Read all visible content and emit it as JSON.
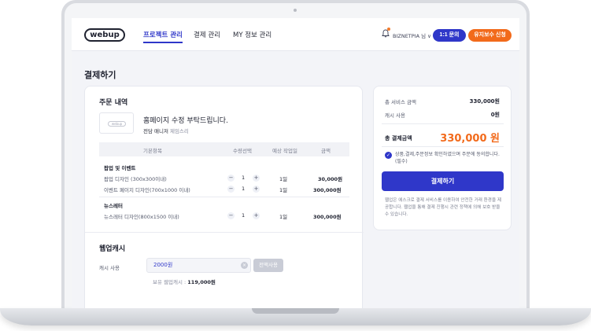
{
  "header": {
    "logo": "webup",
    "nav": [
      "프로젝트 관리",
      "결제 관리",
      "MY 정보 관리"
    ],
    "user": "BIZNETPIA 님 ∨",
    "inquiry_button": "1:1 문의",
    "maintenance_button": "유지보수 신청"
  },
  "page_title": "결제하기",
  "order": {
    "title": "주문 내역",
    "thumb_logo": "webup",
    "product_name": "홈페이지 수정 부탁드립니다.",
    "manager_label": "전담 매니저",
    "manager_name": "제임스리",
    "columns": [
      "기본항목",
      "수량선택",
      "예상 작업일",
      "금액"
    ],
    "groups": [
      {
        "name": "팝업 및 이벤트",
        "items": [
          {
            "name": "팝업 디자인 (300x300이내)",
            "qty": "1",
            "days": "1일",
            "amount": "30,000원"
          },
          {
            "name": "이벤트 페이지 디자인(700x1000 이내)",
            "qty": "1",
            "days": "1일",
            "amount": "300,000원"
          }
        ]
      },
      {
        "name": "뉴스레터",
        "items": [
          {
            "name": "뉴스레터 디자인(800x1500 이내)",
            "qty": "1",
            "days": "1일",
            "amount": "300,000원"
          }
        ]
      }
    ],
    "stepper": {
      "minus": "−",
      "plus": "+"
    }
  },
  "cash": {
    "title": "웹업캐시",
    "label": "캐시 사용",
    "value": "2000원",
    "clear": "×",
    "use_all": "전액사용",
    "own_label": "보유 웹업캐시 :",
    "own_value": "119,000원"
  },
  "summary": {
    "service_label": "총 서비스 금액",
    "service_value": "330,000원",
    "cash_label": "캐시 사용",
    "cash_value": "0원",
    "total_label": "총 결제금액",
    "total_value": "330,000 원",
    "agree_text": "상품,결제,주문정보 확인하였으며 주문에 동의합니다.(필수)",
    "check": "✓",
    "pay_button": "결제하기",
    "notice": "웹업은 에스크로 결제 서비스를 이용하여 안전한 거래 환경을 제공합니다. 웹업을 통해 결제 진행시 관련 정책에 의해 보호 받을 수 있습니다."
  },
  "colors": {
    "primary": "#2f37c9",
    "accent": "#f26a1b"
  }
}
